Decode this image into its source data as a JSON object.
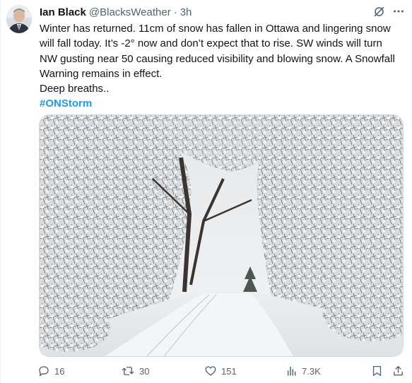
{
  "tweet": {
    "author_name": "Ian Black",
    "author_handle": "@BlacksWeather",
    "separator": "·",
    "time": "3h",
    "text_lines": [
      "Winter has returned. 11cm of snow has fallen in Ottawa and lingering snow",
      "will fall today. It’s -2° now and don’t expect that to rise. SW winds will turn",
      "NW gusting near 50 causing reduced visibility and blowing snow. A Snowfall",
      "Warning remains in effect.",
      "Deep breaths.."
    ],
    "hashtag": "#ONStorm"
  },
  "actions": {
    "replies": "16",
    "reposts": "30",
    "likes": "151",
    "views": "7.3K"
  },
  "icons": {
    "grok": "grok-icon",
    "more": "more-dots-icon",
    "reply": "reply-icon",
    "repost": "repost-icon",
    "like": "heart-icon",
    "views": "views-chart-icon",
    "bookmark": "bookmark-icon",
    "share": "share-icon"
  },
  "colors": {
    "text": "#0f1419",
    "secondary": "#536471",
    "hashtag": "#1d9bf0"
  }
}
